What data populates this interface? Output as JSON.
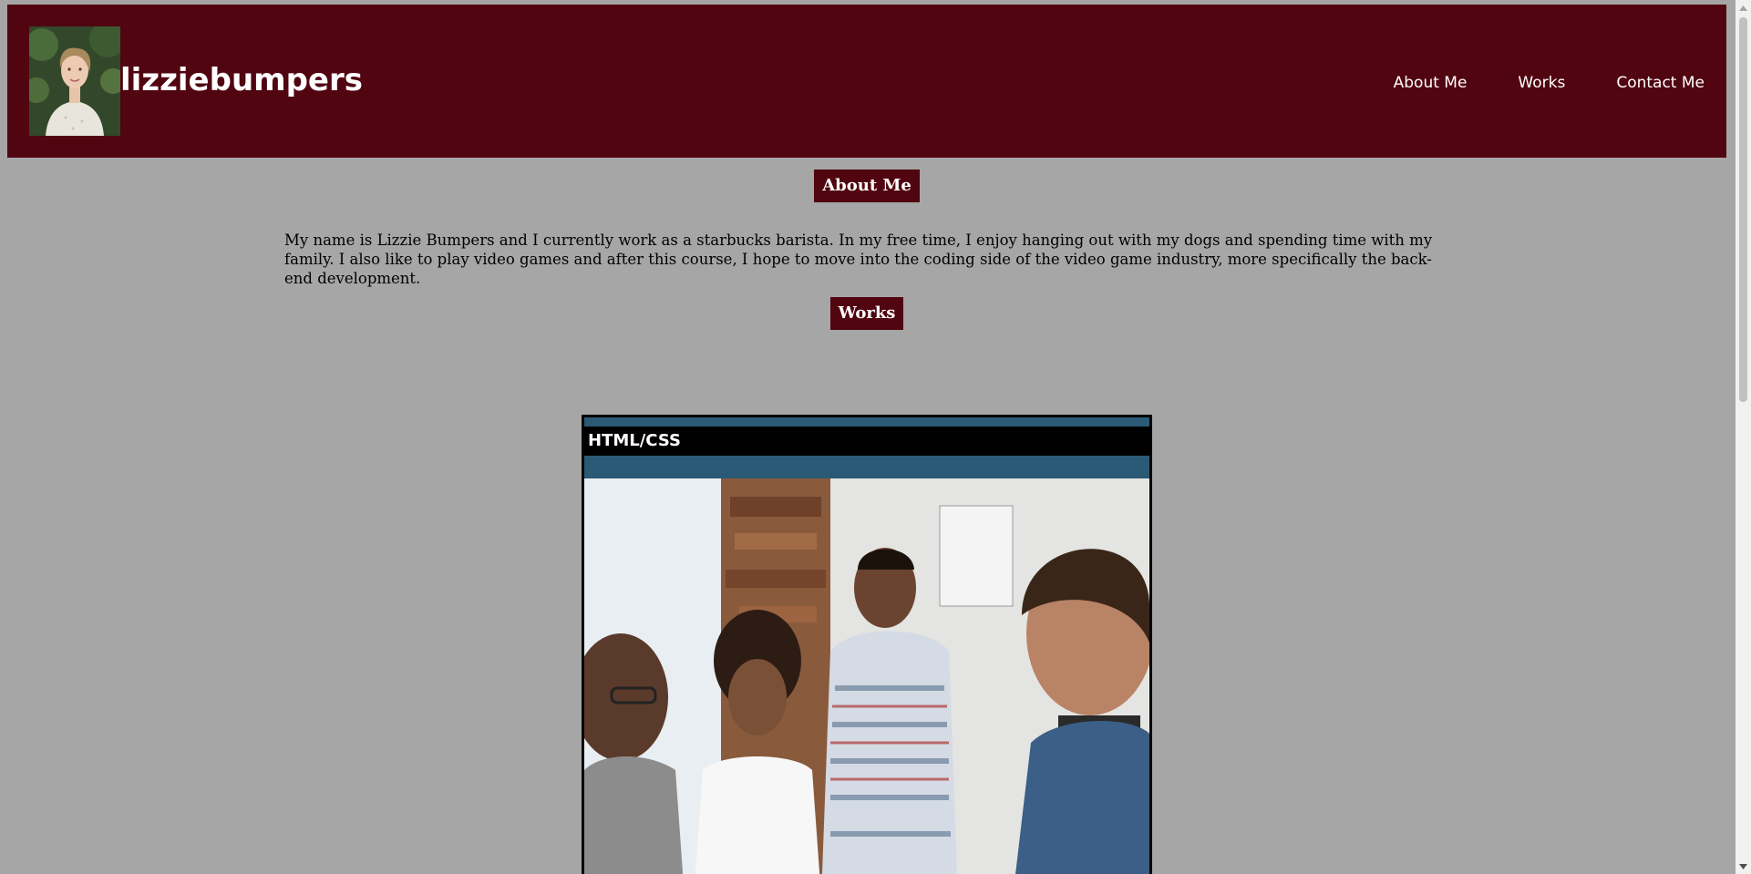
{
  "header": {
    "site_title": "lizziebumpers",
    "avatar_alt": "portrait-photo",
    "nav": [
      {
        "label": "About Me"
      },
      {
        "label": "Works"
      },
      {
        "label": "Contact Me"
      }
    ]
  },
  "about": {
    "heading": "About Me",
    "text": "My name is Lizzie Bumpers and I currently work as a starbucks barista. In my free time, I enjoy hanging out with my dogs and spending time with my family. I also like to play video games and after this course, I hope to move into the coding side of the video game industry, more specifically the back-end development."
  },
  "works": {
    "heading": "Works",
    "items": [
      {
        "label": "HTML/CSS",
        "image": "team-meeting-photo"
      }
    ]
  },
  "colors": {
    "page_background": "#a6a6a6",
    "header_background": "#510510",
    "heading_background": "#510510",
    "card_accent": "#2a5a75"
  }
}
